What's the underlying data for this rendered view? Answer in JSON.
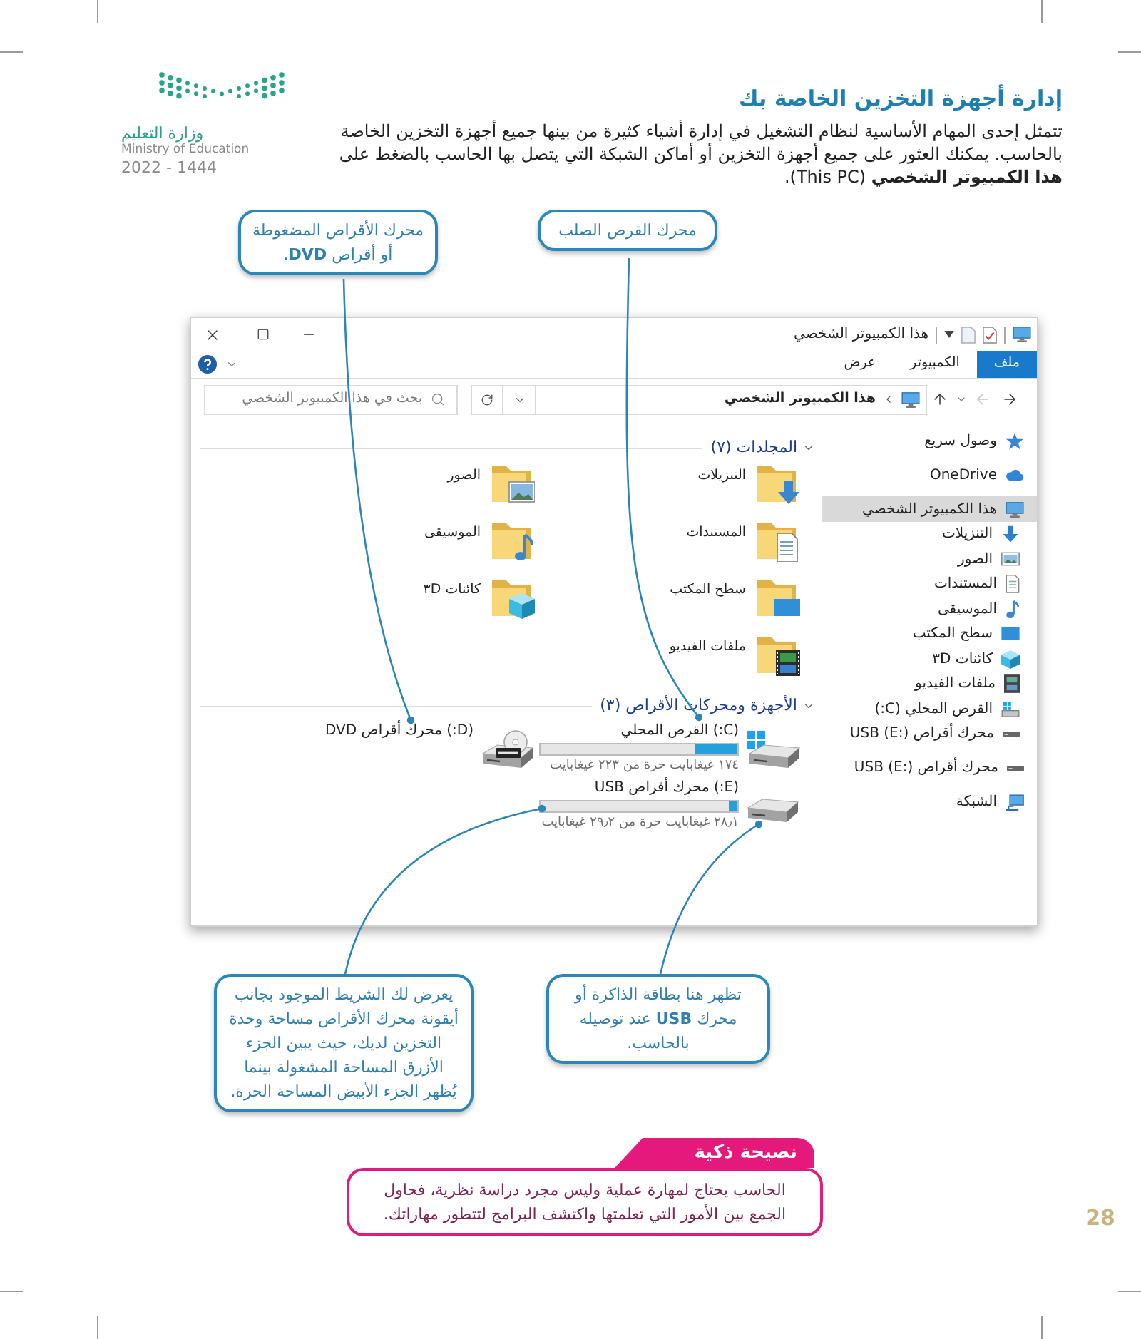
{
  "header": {
    "logo": {
      "name_ar": "وزارة التعليم",
      "name_en": "Ministry of Education",
      "year": "2022 - 1444"
    },
    "title": "إدارة أجهزة التخزين الخاصة بك",
    "paragraph": "تتمثل إحدى المهام الأساسية لنظام التشغيل في إدارة أشياء كثيرة من بينها جميع أجهزة التخزين الخاصة بالحاسب. يمكنك العثور على جميع أجهزة التخزين أو أماكن الشبكة التي يتصل بها الحاسب بالضغط على **هذا الكمبيوتر الشخصي** (This PC)."
  },
  "top_callouts": [
    {
      "text": "محرك القرص الصلب"
    },
    {
      "text": "محرك الأقراص المضغوطة أو أقراص **DVD**."
    }
  ],
  "explorer": {
    "title": "هذا الكمبيوتر الشخصي",
    "ribbon_tabs": [
      {
        "label": "ملف",
        "selected": true
      },
      {
        "label": "الكمبيوتر",
        "selected": false
      },
      {
        "label": "عرض",
        "selected": false
      }
    ],
    "address": "هذا الكمبيوتر الشخصي",
    "search": {
      "placeholder": "بحث في هذا الكمبيوتر الشخصي"
    },
    "navigation": [
      {
        "label": "وصول سريع",
        "kind": "quick",
        "selected": false
      },
      {
        "label": "OneDrive",
        "kind": "cloud",
        "selected": false
      },
      {
        "label": "هذا الكمبيوتر الشخصي",
        "kind": "pc",
        "selected": true,
        "children": [
          {
            "label": "التنزيلات",
            "kind": "downloads",
            "selected": false
          },
          {
            "label": "الصور",
            "kind": "pictures",
            "selected": false
          },
          {
            "label": "المستندات",
            "kind": "documents",
            "selected": false
          },
          {
            "label": "الموسيقى",
            "kind": "music",
            "selected": false
          },
          {
            "label": "سطح المكتب",
            "kind": "desktop",
            "selected": false
          },
          {
            "label": "كائنات ٣D",
            "kind": "objects",
            "selected": false
          },
          {
            "label": "ملفات الفيديو",
            "kind": "videos",
            "selected": false
          },
          {
            "label": "القرص المحلي (C:)",
            "kind": "system",
            "selected": false
          },
          {
            "label": "محرك أقراص USB (E:)",
            "kind": "usb",
            "selected": false
          }
        ]
      },
      {
        "label": "محرك أقراص USB (E:)",
        "kind": "usb",
        "selected": false
      },
      {
        "label": "الشبكة",
        "kind": "network",
        "selected": false
      }
    ],
    "folders_title": "المجلدات (٧)",
    "folders": [
      {
        "name": "التنزيلات",
        "kind": "downloads"
      },
      {
        "name": "الصور",
        "kind": "pictures"
      },
      {
        "name": "المستندات",
        "kind": "documents"
      },
      {
        "name": "الموسيقى",
        "kind": "music"
      },
      {
        "name": "سطح المكتب",
        "kind": "desktop"
      },
      {
        "name": "كائنات ٣D",
        "kind": "objects"
      },
      {
        "name": "ملفات الفيديو",
        "kind": "videos"
      }
    ],
    "devices_title": "الأجهزة ومحركات الأقراص (٣)",
    "drives": [
      {
        "name": "(C:) القرص المحلي",
        "kind": "system",
        "level": 0.22,
        "reading": "١٧٤ غيغابايت حرة من ٢٢٣ غيغابايت"
      },
      {
        "name": "(D:) محرك أقراص DVD",
        "kind": "dvd"
      },
      {
        "name": "(E:) محرك أقراص USB",
        "kind": "usb",
        "level": 0.04,
        "reading": "٢٨٫١ غيغابايت حرة من ٢٩٫٢ غيغابايت"
      }
    ]
  },
  "bottom_callouts": [
    {
      "text": "تظهر هنا بطاقة الذاكرة أو محرك **USB** عند توصيله بالحاسب."
    },
    {
      "text": "يعرض لك الشريط الموجود بجانب أيقونة محرك الأقراص مساحة وحدة التخزين لديك، حيث يبين الجزء الأزرق المساحة المشغولة بينما يُظهر الجزء الأبيض المساحة الحرة."
    }
  ],
  "tip": {
    "title": "نصيحة ذكية",
    "text": "الحاسب يحتاج لمهارة عملية وليس مجرد دراسة نظرية، فحاول الجمع بين الأمور التي تعلمتها واكتشف البرامج لتتطور مهاراتك."
  },
  "page_number": "28"
}
